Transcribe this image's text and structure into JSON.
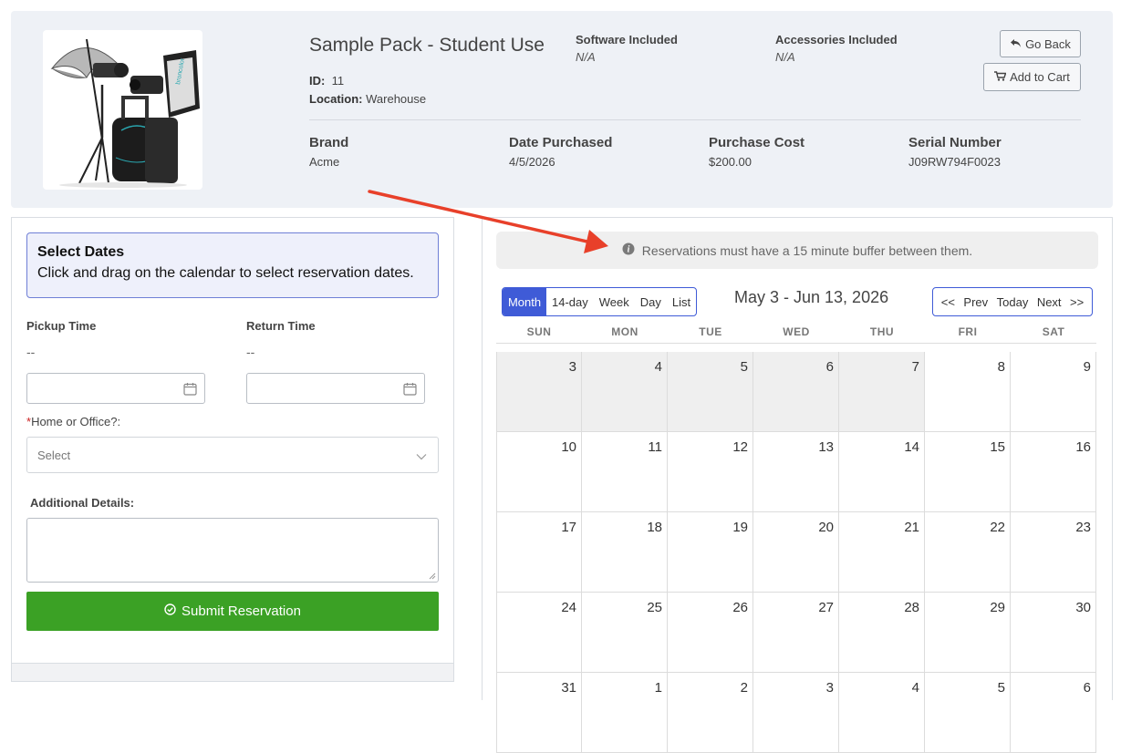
{
  "product": {
    "title": "Sample Pack - Student Use",
    "id_label": "ID:",
    "id_value": "11",
    "location_label": "Location:",
    "location_value": "Warehouse",
    "software_label": "Software Included",
    "software_value": "N/A",
    "accessories_label": "Accessories Included",
    "accessories_value": "N/A",
    "brand_label": "Brand",
    "brand_value": "Acme",
    "date_label": "Date Purchased",
    "date_value": "4/5/2026",
    "cost_label": "Purchase Cost",
    "cost_value": "$200.00",
    "serial_label": "Serial Number",
    "serial_value": "J09RW794F0023"
  },
  "actions": {
    "go_back": "Go Back",
    "add_to_cart": "Add to Cart"
  },
  "form": {
    "info_heading": "Select Dates",
    "info_text": "Click and drag on the calendar to select reservation dates.",
    "pickup_label": "Pickup Time",
    "pickup_value": "--",
    "return_label": "Return Time",
    "return_value": "--",
    "required_mark": "*",
    "home_office_label": "Home or Office?:",
    "select_placeholder": "Select",
    "details_label": "Additional Details:",
    "submit_label": "Submit Reservation"
  },
  "calendar": {
    "notice": "Reservations must have a 15 minute buffer between them.",
    "views": [
      "Month",
      "14-day",
      "Week",
      "Day",
      "List"
    ],
    "active_view": "Month",
    "range_title": "May 3 - Jun 13, 2026",
    "nav": [
      "<<",
      "Prev",
      "Today",
      "Next",
      ">>"
    ],
    "weekdays": [
      "SUN",
      "MON",
      "TUE",
      "WED",
      "THU",
      "FRI",
      "SAT"
    ],
    "weeks": [
      [
        "3",
        "4",
        "5",
        "6",
        "7",
        "8",
        "9"
      ],
      [
        "10",
        "11",
        "12",
        "13",
        "14",
        "15",
        "16"
      ],
      [
        "17",
        "18",
        "19",
        "20",
        "21",
        "22",
        "23"
      ],
      [
        "24",
        "25",
        "26",
        "27",
        "28",
        "29",
        "30"
      ],
      [
        "31",
        "1",
        "2",
        "3",
        "4",
        "5",
        "6"
      ]
    ],
    "past_days_in_first_week": 5
  },
  "colors": {
    "accent_blue": "#3f5bd7",
    "submit_green": "#3ba125",
    "arrow_red": "#e8402a"
  }
}
